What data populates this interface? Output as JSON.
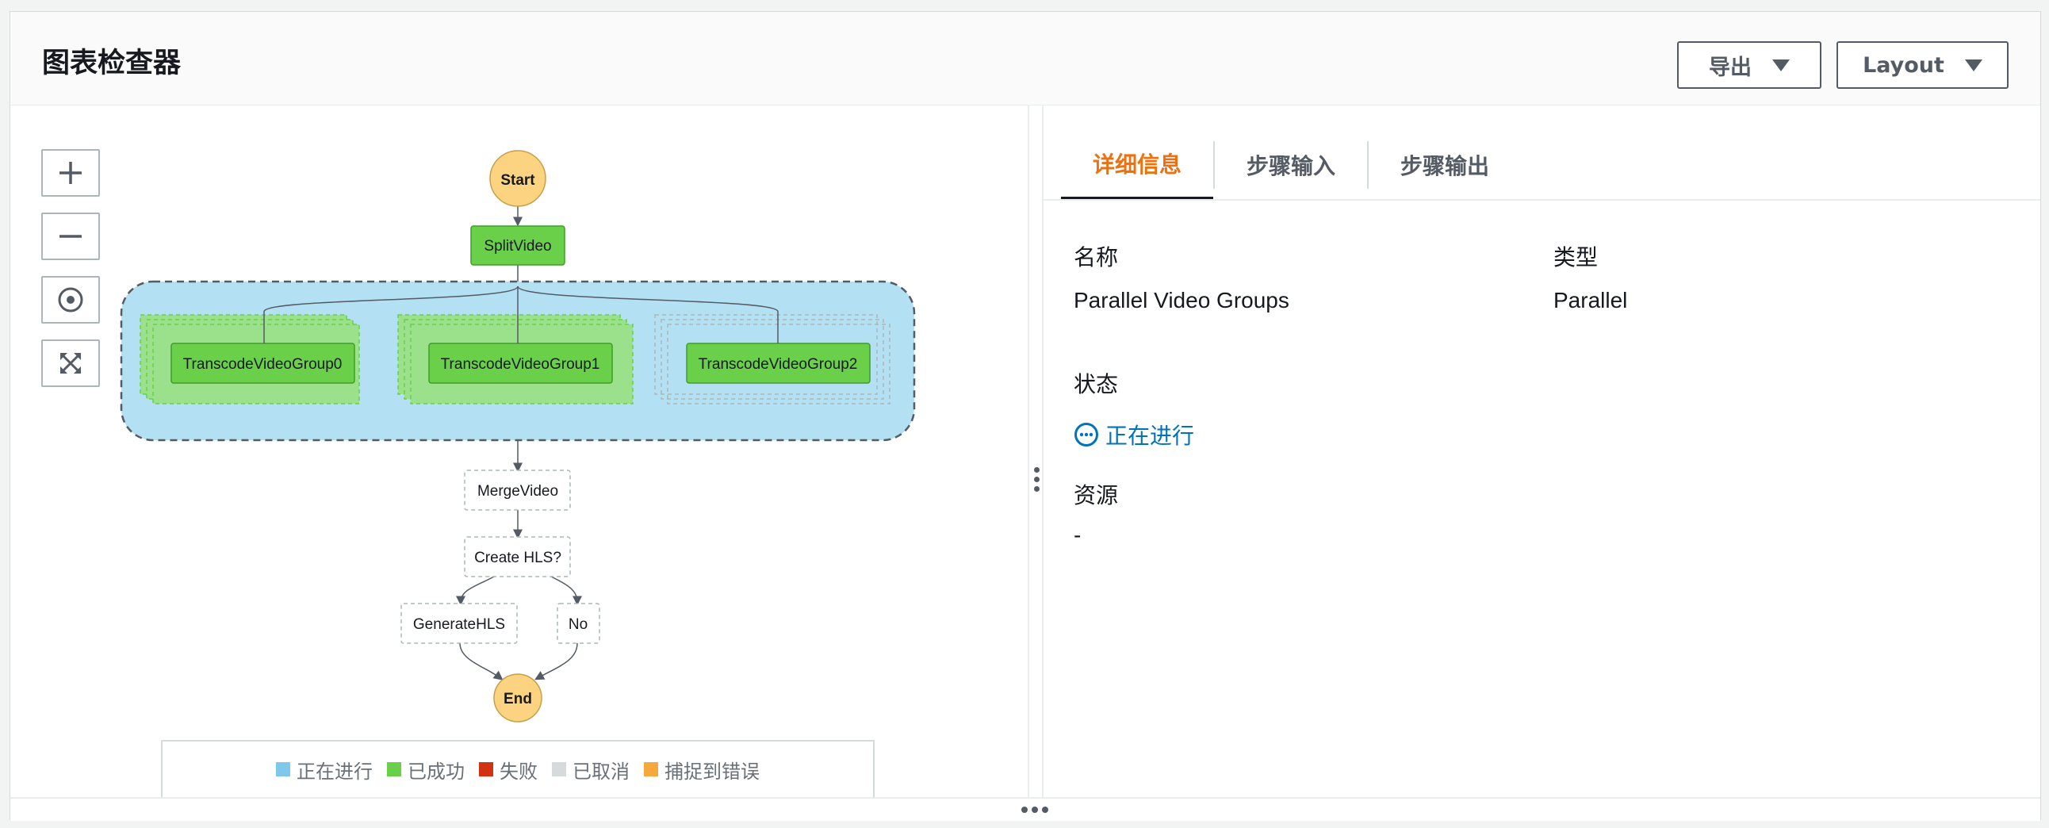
{
  "header": {
    "title": "图表检查器",
    "export_label": "导出",
    "layout_label": "Layout"
  },
  "zoom_controls": [
    "zoom-in",
    "zoom-out",
    "center",
    "fit"
  ],
  "graph": {
    "start": "Start",
    "split": "SplitVideo",
    "groups": [
      "TranscodeVideoGroup0",
      "TranscodeVideoGroup1",
      "TranscodeVideoGroup2"
    ],
    "merge": "MergeVideo",
    "choice": "Create HLS?",
    "generate": "GenerateHLS",
    "no": "No",
    "end": "End"
  },
  "legend": [
    {
      "label": "正在进行",
      "color": "#7ec9ea"
    },
    {
      "label": "已成功",
      "color": "#6ad04a"
    },
    {
      "label": "失败",
      "color": "#d13212"
    },
    {
      "label": "已取消",
      "color": "#d5dbdb"
    },
    {
      "label": "捕捉到错误",
      "color": "#f5a93d"
    }
  ],
  "tabs": [
    "详细信息",
    "步骤输入",
    "步骤输出"
  ],
  "details": {
    "name_label": "名称",
    "name_value": "Parallel Video Groups",
    "type_label": "类型",
    "type_value": "Parallel",
    "status_label": "状态",
    "status_value": "正在进行",
    "resource_label": "资源",
    "resource_value": "-"
  },
  "colors": {
    "accent": "#ec7211",
    "in_progress": "#0073bb",
    "success": "#6ad04a"
  }
}
